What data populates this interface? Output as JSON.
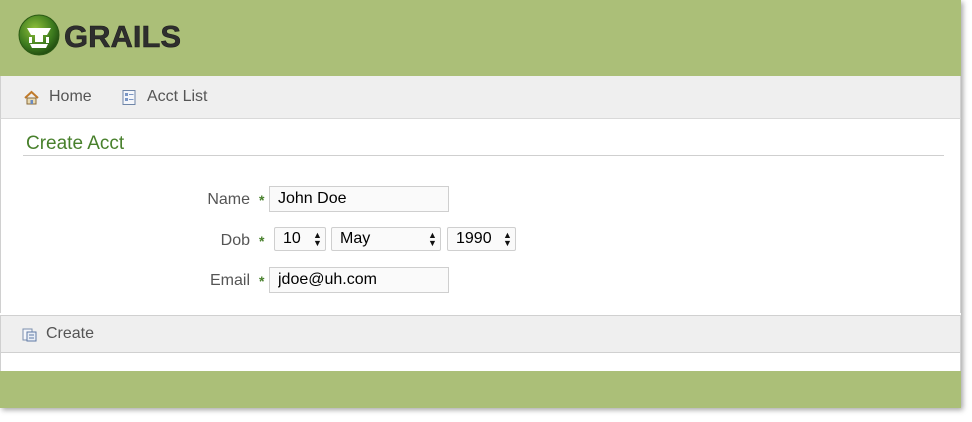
{
  "header": {
    "logo_text": "GRAILS",
    "colors": {
      "bar": "#abbf78",
      "accent": "#48802c"
    }
  },
  "nav": {
    "items": [
      {
        "label": "Home",
        "icon": "home-icon"
      },
      {
        "label": "Acct List",
        "icon": "list-icon"
      }
    ]
  },
  "form": {
    "title": "Create Acct",
    "required_marker": "*",
    "fields": {
      "name": {
        "label": "Name",
        "value": "John Doe"
      },
      "dob": {
        "label": "Dob",
        "day": "10",
        "month": "May",
        "year": "1990"
      },
      "email": {
        "label": "Email",
        "value": "jdoe@uh.com"
      }
    }
  },
  "buttons": {
    "create_label": "Create",
    "create_icon": "create-icon"
  }
}
